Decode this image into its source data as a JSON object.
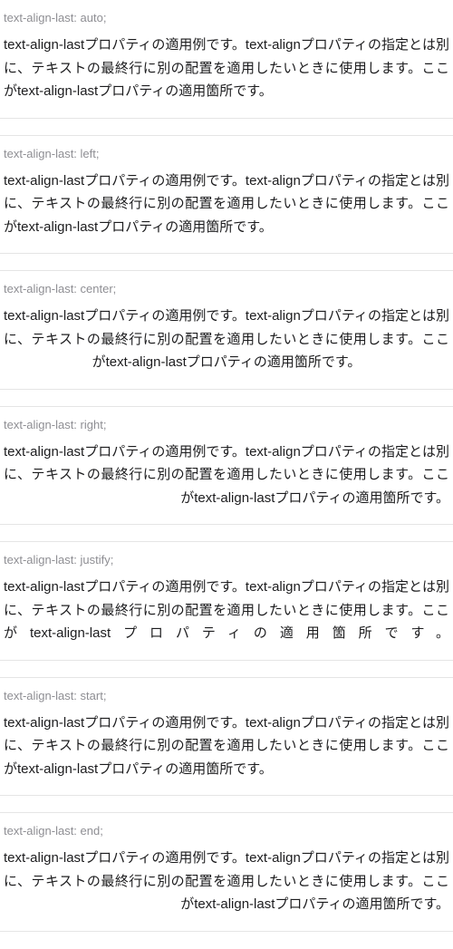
{
  "sample_text": "text-align-lastプロパティの適用例です。text-alignプロパティの指定とは別に、テキストの最終行に別の配置を適用したいときに使用します。ここがtext-align-lastプロパティの適用箇所です。",
  "examples": [
    {
      "label": "text-align-last: auto;",
      "class": "tal-auto"
    },
    {
      "label": "text-align-last: left;",
      "class": "tal-left"
    },
    {
      "label": "text-align-last: center;",
      "class": "tal-center"
    },
    {
      "label": "text-align-last: right;",
      "class": "tal-right"
    },
    {
      "label": "text-align-last: justify;",
      "class": "tal-justify"
    },
    {
      "label": "text-align-last: start;",
      "class": "tal-start"
    },
    {
      "label": "text-align-last: end;",
      "class": "tal-end"
    }
  ]
}
